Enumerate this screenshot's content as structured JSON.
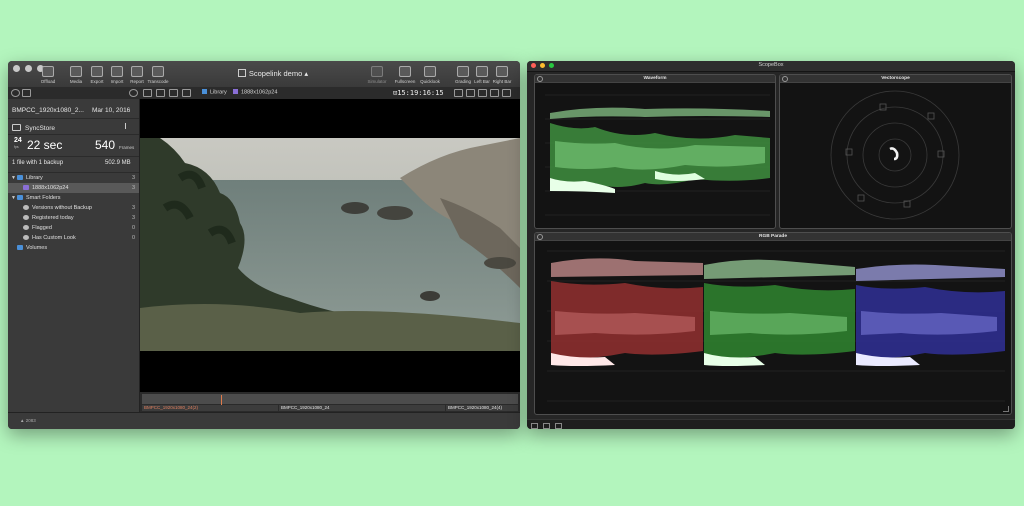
{
  "left_window": {
    "title": "Scopelink demo",
    "toolbar": {
      "offload": "Offload",
      "media": "Media",
      "export": "Export",
      "import": "Import",
      "report": "Report",
      "transcode": "Transcode",
      "simulator": "Simulator",
      "fullscreen": "Fullscreen",
      "quicklook": "Quicklook",
      "grading": "Grading",
      "left_bar": "Left Bar",
      "right_bar": "Right Bar"
    },
    "breadcrumb": [
      "Library",
      "1888x1062p24"
    ],
    "timecode": "15:19:16:15",
    "sidebar": {
      "clip_name": "BMPCC_1920x1080_2...",
      "clip_date": "Mar 10, 2016",
      "store_name": "SyncStore",
      "fps": "24",
      "fps_unit": "fps",
      "duration": "22 sec",
      "frames": "540",
      "frames_label": "Frames",
      "backup_info": "1 file with 1 backup",
      "backup_size": "502.9 MB",
      "library": {
        "label": "Library",
        "count": "3",
        "items": [
          {
            "label": "1888x1062p24",
            "count": "3"
          }
        ]
      },
      "smart_folders": {
        "label": "Smart Folders",
        "items": [
          {
            "label": "Versions without Backup",
            "count": "3"
          },
          {
            "label": "Registered today",
            "count": "3"
          },
          {
            "label": "Flagged",
            "count": "0"
          },
          {
            "label": "Has Custom Look",
            "count": "0"
          }
        ]
      },
      "volumes": {
        "label": "Volumes"
      }
    },
    "timeline": {
      "playhead_fraction": 0.21,
      "segments": [
        "BMPCC_1920x1080_24(2)",
        "BMPCC_1920x1080_24",
        "BMPCC_1920x1080_24(4)"
      ]
    },
    "status": "▲ 2083"
  },
  "right_window": {
    "title": "ScopeBox",
    "panels": {
      "waveform": "Waveform",
      "vectorscope": "Vectorscope",
      "rgb_parade": "RGB Parade"
    }
  },
  "colors": {
    "desktop": "#b3f5bd",
    "accent_blue": "#4a90d9",
    "clip_purple": "#8a6fd6",
    "playhead": "#e07a4a",
    "scope_red": "#c94a4a",
    "scope_green": "#4fb84f",
    "scope_blue": "#5a5ad6"
  }
}
